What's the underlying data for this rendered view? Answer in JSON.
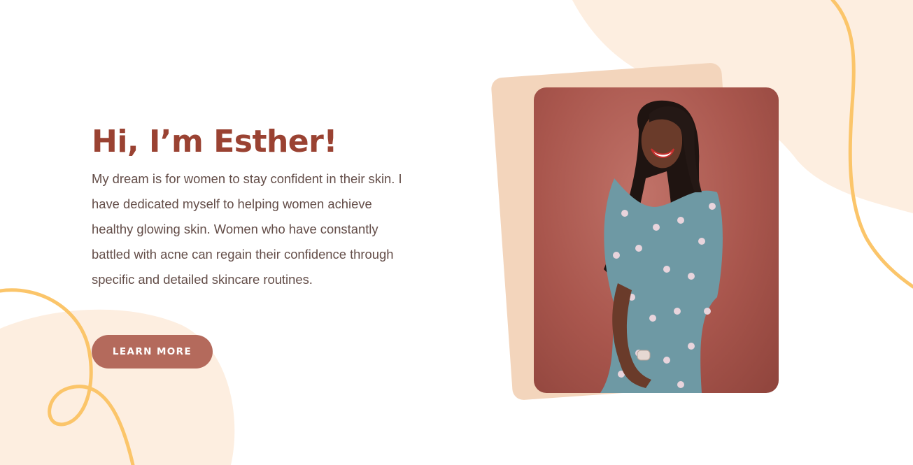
{
  "hero": {
    "title": "Hi, I’m Esther!",
    "body": "My dream is for women to stay confident in their skin. I have dedicated myself to helping women achieve healthy glowing skin. Women who have constantly battled with acne can regain their confidence through specific and detailed skincare routines.",
    "cta_label": "LEARN MORE"
  },
  "colors": {
    "heading": "#9a4232",
    "body_text": "#634d48",
    "button": "#b46a5c",
    "blob": "#fdeee0",
    "squiggle": "#fbc56a",
    "photo_backing": "#f3d5bc"
  }
}
